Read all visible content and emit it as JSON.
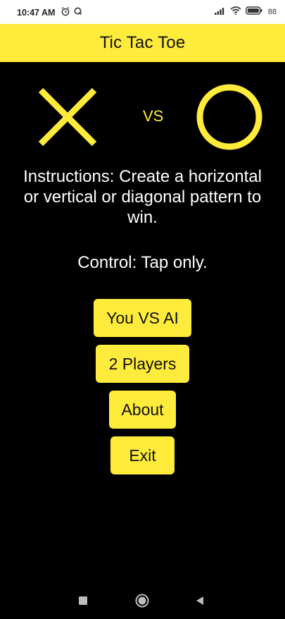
{
  "status_bar": {
    "time": "10:47 AM",
    "left_icons": [
      "alarm-icon",
      "q-app-icon"
    ],
    "right_icons": [
      "signal-icon",
      "wifi-icon",
      "battery-icon"
    ],
    "battery": "88"
  },
  "app_bar": {
    "title": "Tic Tac Toe"
  },
  "hero": {
    "player_one_icon": "x-mark-icon",
    "vs_label": "VS",
    "player_two_icon": "o-mark-icon"
  },
  "instructions": {
    "text": "Instructions: Create a horizontal or vertical or diagonal pattern to win.",
    "control": "Control: Tap only."
  },
  "menu": {
    "you_vs_ai": "You VS AI",
    "two_players": "2 Players",
    "about": "About",
    "exit": "Exit"
  },
  "nav_bar": {
    "icons": [
      "recents-icon",
      "home-icon",
      "back-icon"
    ]
  },
  "colors": {
    "accent": "#ffeb3b",
    "background": "#000000",
    "text": "#ffffff"
  }
}
